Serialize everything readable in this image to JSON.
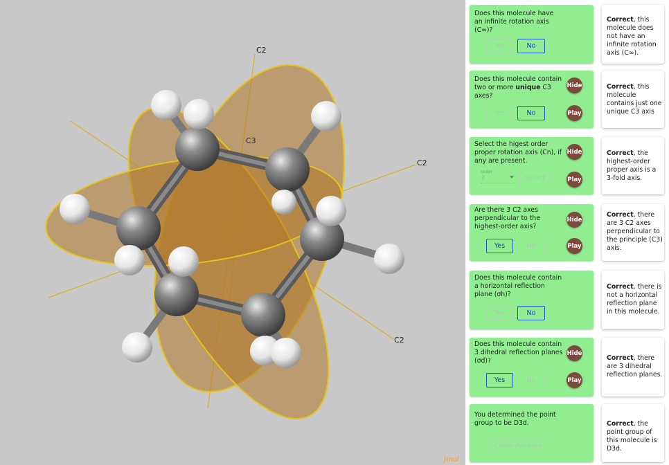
{
  "viewer": {
    "axis_labels": {
      "c2_top": "C2",
      "c3": "C3",
      "c2_right": "C2",
      "c2_bottom": "C2"
    },
    "watermark": "Jmol"
  },
  "questions": [
    {
      "text": "Does this molecule have an infinite rotation axis (C∞)?",
      "buttons": {
        "yes": "Yes",
        "no": "No"
      },
      "selected": "no",
      "answer_bold": "Correct",
      "answer_rest": ", this molecule does not have an infinite rotation axis (C∞)."
    },
    {
      "text_pre": "Does this molecule contain two or more ",
      "text_bold": "unique",
      "text_post": " C3 axes?",
      "buttons": {
        "yes": "Yes",
        "no": "No"
      },
      "selected": "no",
      "hide": "Hide",
      "play": "Play",
      "answer_bold": "Correct",
      "answer_rest": ", this molecule contains just one unique C3 axis"
    },
    {
      "text": "Select the higest order proper rotation axis (Cn), if any are present.",
      "select_label": "order",
      "select_value": "3",
      "select_button": "Select",
      "hide": "Hide",
      "play": "Play",
      "answer_bold": "Correct",
      "answer_rest": ", the highest-order proper axis is a 3-fold axis."
    },
    {
      "text": "Are there 3 C2 axes perpendicular to the highest-order axis?",
      "buttons": {
        "yes": "Yes",
        "no": "No"
      },
      "selected": "yes",
      "hide": "Hide",
      "play": "Play",
      "answer_bold": "Correct",
      "answer_rest": ", there are 3 C2 axes perpendicular to the principle (C3) axis."
    },
    {
      "text": "Does this molecule contain a horizontal reflection plane (σh)?",
      "buttons": {
        "yes": "Yes",
        "no": "No"
      },
      "selected": "no",
      "answer_bold": "Correct",
      "answer_rest": ", there is not a horizontal reflection plane in this molecule."
    },
    {
      "text": "Does this molecule contain 3 dihedral reflection planes (σd)?",
      "buttons": {
        "yes": "Yes",
        "no": "No"
      },
      "selected": "yes",
      "hide": "Hide",
      "play": "Play",
      "answer_bold": "Correct",
      "answer_rest": ", there are 3 dihedral reflection planes."
    },
    {
      "text": "You determined the point group to be D3d.",
      "check_button": "Check Answers",
      "answer_bold": "Correct",
      "answer_rest": ", the point group of this molecule is D3d."
    }
  ]
}
